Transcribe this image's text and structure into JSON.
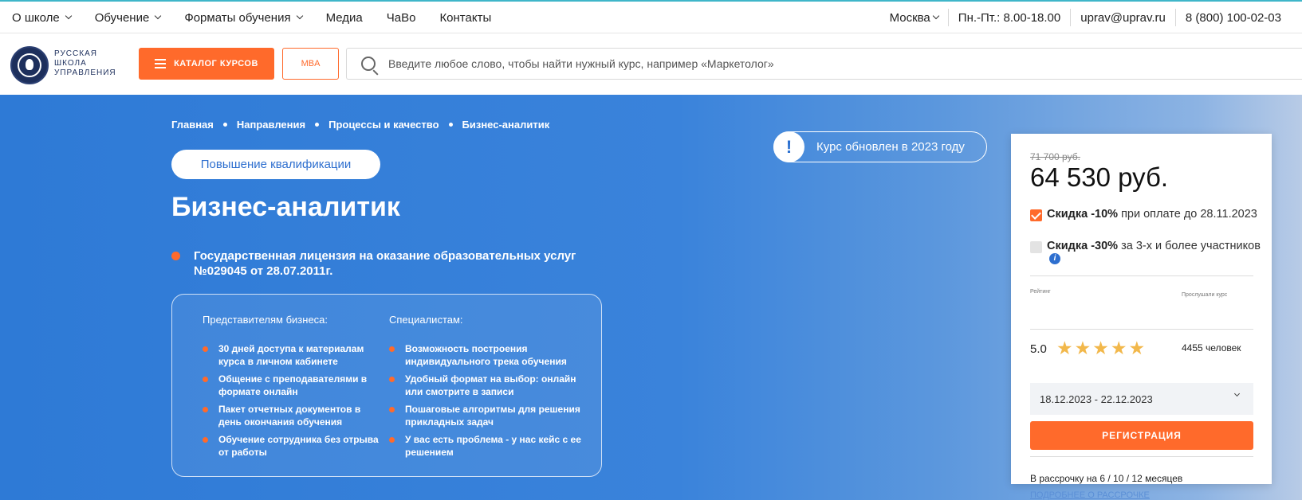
{
  "topnav": {
    "items": [
      "О школе",
      "Обучение",
      "Форматы обучения",
      "Медиа",
      "ЧаВо",
      "Контакты"
    ],
    "city": "Москва",
    "hours": "Пн.-Пт.: 8.00-18.00",
    "email": "uprav@uprav.ru",
    "phone": "8 (800) 100-02-03"
  },
  "header": {
    "logo_text": "Русская школа управления",
    "catalog_label": "КАТАЛОГ КУРСОВ",
    "mba_label": "MBA",
    "search_placeholder": "Введите любое слово, чтобы найти нужный курс, например «Маркетолог»"
  },
  "hero": {
    "breadcrumb": [
      "Главная",
      "Направления",
      "Процессы и качество",
      "Бизнес-аналитик"
    ],
    "badge": "Повышение квалификации",
    "title": "Бизнес-аналитик",
    "license": "Государственная лицензия на оказание образовательных услуг №029045 от 28.07.2011г.",
    "updated": "Курс обновлен в 2023 году",
    "features": {
      "business_title": "Представителям бизнеса:",
      "business_items": [
        "30 дней доступа к материалам курса в личном кабинете",
        "Общение с преподавателями в формате онлайн",
        "Пакет отчетных документов в день окончания обучения",
        "Обучение сотрудника без отрыва от работы"
      ],
      "specialist_title": "Специалистам:",
      "specialist_items": [
        "Возможность построения индивидуального трека обучения",
        "Удобный формат на выбор: онлайн или смотрите в записи",
        "Пошаговые алгоритмы для решения прикладных задач",
        "У вас есть проблема - у нас кейс с ее решением"
      ]
    }
  },
  "card": {
    "old_price": "71 700 руб.",
    "price": "64 530 руб.",
    "discount1_bold": "Скидка -10%",
    "discount1_rest": " при оплате до 28.11.2023",
    "discount2_bold": "Скидка -30%",
    "discount2_rest": " за 3-х и более участников",
    "rating_label": "Рейтинг",
    "rating": "5.0",
    "rating_stars": 5,
    "listeners_label": "Прослушали курс",
    "listeners": "4455 человек",
    "dates": "18.12.2023 - 22.12.2023",
    "register_label": "РЕГИСТРАЦИЯ",
    "installment": "В рассрочку на 6 / 10 / 12 месяцев",
    "installment_link": "ПОДРОБНЕЕ О РАССРОЧКЕ"
  },
  "colors": {
    "accent": "#ff6a2b",
    "hero_blue": "#2e7ad6",
    "link_blue": "#5b8fd6"
  }
}
